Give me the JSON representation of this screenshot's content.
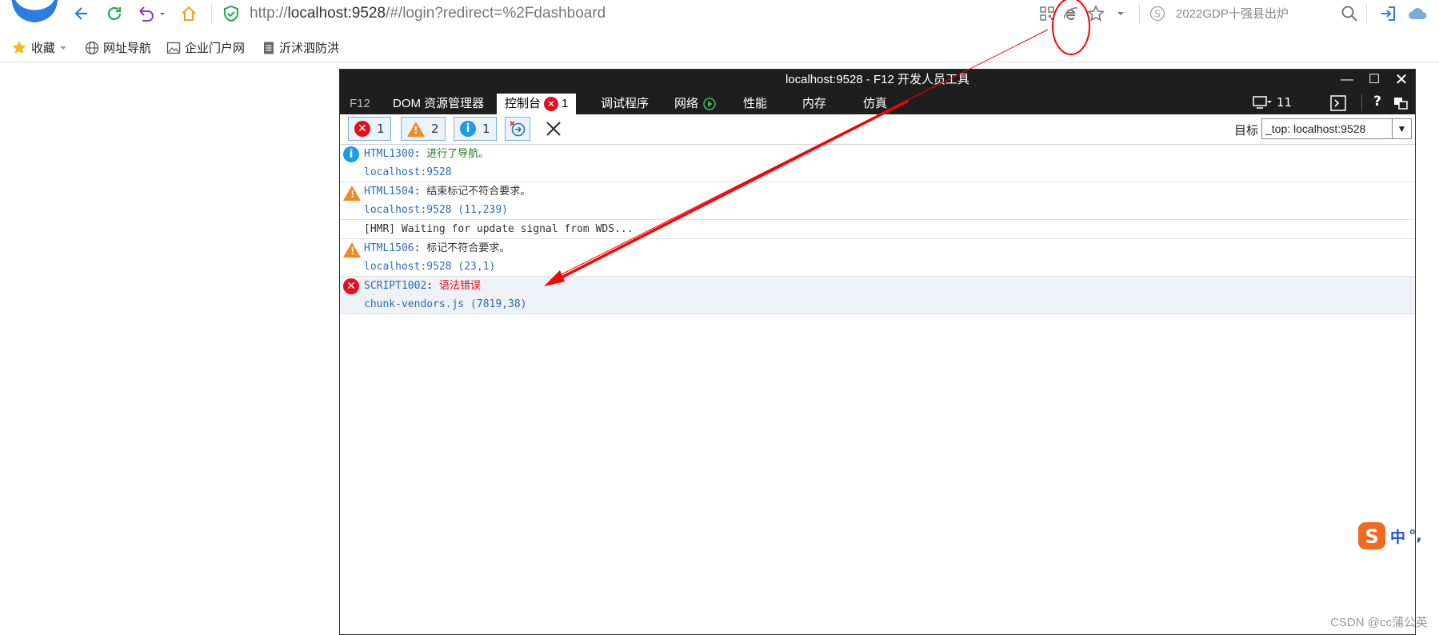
{
  "browser": {
    "url_prefix": "http://",
    "url_host": "localhost:9528",
    "url_path": "/#/login?redirect=%2Fdashboard",
    "search_text": "2022GDP十强县出炉",
    "icons": [
      "browser-logo-icon",
      "back-icon",
      "refresh-icon",
      "undo-icon",
      "home-icon",
      "shield-icon",
      "grid-icon",
      "ie-icon",
      "star-icon",
      "search-icon",
      "login-icon",
      "cloud-icon"
    ]
  },
  "bookmarks": [
    {
      "label": "收藏",
      "icon": "star-icon"
    },
    {
      "label": "网址导航",
      "icon": "globe-icon"
    },
    {
      "label": "企业门户网",
      "icon": "image-icon"
    },
    {
      "label": "沂沭泗防洪",
      "icon": "doc-icon"
    }
  ],
  "devtools": {
    "title": "localhost:9528 - F12 开发人员工具",
    "tabs": [
      "F12",
      "DOM 资源管理器",
      "控制台",
      "1",
      "调试程序",
      "网络",
      "性能",
      "内存",
      "仿真"
    ],
    "right_count": "11",
    "filters": {
      "errors": "1",
      "warnings": "2",
      "info": "1"
    },
    "target_label": "目标",
    "target_value": "_top: localhost:9528",
    "logs": [
      {
        "type": "info",
        "code": "HTML1300",
        "message": "进行了导航。",
        "source": "localhost:9528"
      },
      {
        "type": "warning",
        "code": "HTML1504",
        "message": "结束标记不符合要求。",
        "source": "localhost:9528 (11,239)"
      },
      {
        "type": "plain",
        "message": "[HMR] Waiting for update signal from WDS..."
      },
      {
        "type": "warning",
        "code": "HTML1506",
        "message": "标记不符合要求。",
        "source": "localhost:9528 (23,1)"
      },
      {
        "type": "error",
        "code": "SCRIPT1002",
        "message": "语法错误",
        "source": "chunk-vendors.js (7819,38)"
      }
    ]
  },
  "ime": {
    "label": "中"
  },
  "watermark": "CSDN @cc蒲公英",
  "colors": {
    "error": "#e0101c",
    "warning": "#f08a24",
    "info": "#1e9be8",
    "annotation": "#ff0000"
  }
}
